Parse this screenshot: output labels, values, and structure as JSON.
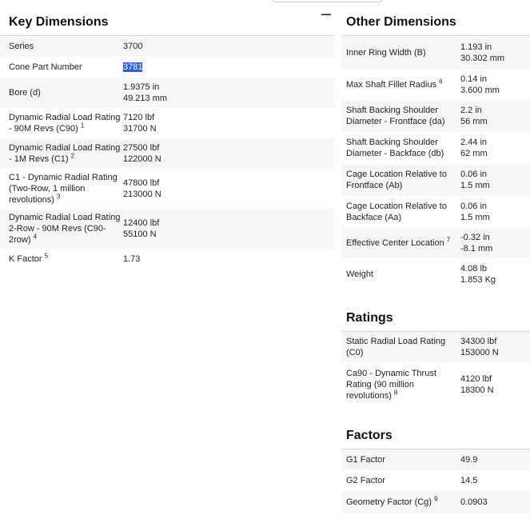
{
  "key_dimensions": {
    "title": "Key Dimensions",
    "collapse_icon": "minus-icon",
    "rows": [
      {
        "label": "Series",
        "sup": "",
        "values": [
          "3700"
        ]
      },
      {
        "label": "Cone Part Number",
        "sup": "",
        "values": [
          "3781"
        ],
        "highlighted": true
      },
      {
        "label": "Bore (d)",
        "sup": "",
        "values": [
          "1.9375 in",
          "49.213 mm"
        ]
      },
      {
        "label": "Dynamic Radial Load Rating - 90M Revs (C90)",
        "sup": "1",
        "values": [
          "7120 lbf",
          "31700 N"
        ]
      },
      {
        "label": "Dynamic Radial Load Rating - 1M Revs (C1)",
        "sup": "2",
        "values": [
          "27500 lbf",
          "122000 N"
        ]
      },
      {
        "label": "C1 - Dynamic Radial Rating (Two-Row, 1 million revolutions)",
        "sup": "3",
        "values": [
          "47800 lbf",
          "213000 N"
        ]
      },
      {
        "label": "Dynamic Radial Load Rating 2-Row - 90M Revs (C90-2row)",
        "sup": "4",
        "values": [
          "12400 lbf",
          "55100 N"
        ]
      },
      {
        "label": "K Factor",
        "sup": "5",
        "values": [
          "1.73"
        ]
      }
    ]
  },
  "other_dimensions": {
    "title": "Other Dimensions",
    "rows": [
      {
        "label": "Inner Ring Width (B)",
        "sup": "",
        "values": [
          "1.193 in",
          "30.302 mm"
        ]
      },
      {
        "label": "Max Shaft Fillet Radius",
        "sup": "6",
        "values": [
          "0.14 in",
          "3.600 mm"
        ]
      },
      {
        "label": "Shaft Backing Shoulder Diameter - Frontface (da)",
        "sup": "",
        "values": [
          "2.2 in",
          "56 mm"
        ]
      },
      {
        "label": "Shaft Backing Shoulder Diameter - Backface (db)",
        "sup": "",
        "values": [
          "2.44 in",
          "62 mm"
        ]
      },
      {
        "label": "Cage Location Relative to Frontface (Ab)",
        "sup": "",
        "values": [
          "0.06 in",
          "1.5 mm"
        ]
      },
      {
        "label": "Cage Location Relative to Backface (Aa)",
        "sup": "",
        "values": [
          "0.06 in",
          "1.5 mm"
        ]
      },
      {
        "label": "Effective Center Location",
        "sup": "7",
        "values": [
          "-0.32 in",
          "-8.1 mm"
        ]
      },
      {
        "label": "Weight",
        "sup": "",
        "values": [
          "4.08 lb",
          "1.853 Kg"
        ]
      }
    ]
  },
  "ratings": {
    "title": "Ratings",
    "rows": [
      {
        "label": "Static Radial Load Rating (C0)",
        "sup": "",
        "values": [
          "34300 lbf",
          "153000 N"
        ]
      },
      {
        "label": "Ca90 - Dynamic Thrust Rating (90 million revolutions)",
        "sup": "8",
        "values": [
          "4120 lbf",
          "18300 N"
        ]
      }
    ]
  },
  "factors": {
    "title": "Factors",
    "rows": [
      {
        "label": "G1 Factor",
        "sup": "",
        "values": [
          "49.9"
        ]
      },
      {
        "label": "G2 Factor",
        "sup": "",
        "values": [
          "14.5"
        ]
      },
      {
        "label": "Geometry Factor (Cg)",
        "sup": "9",
        "values": [
          "0.0903"
        ]
      }
    ]
  }
}
